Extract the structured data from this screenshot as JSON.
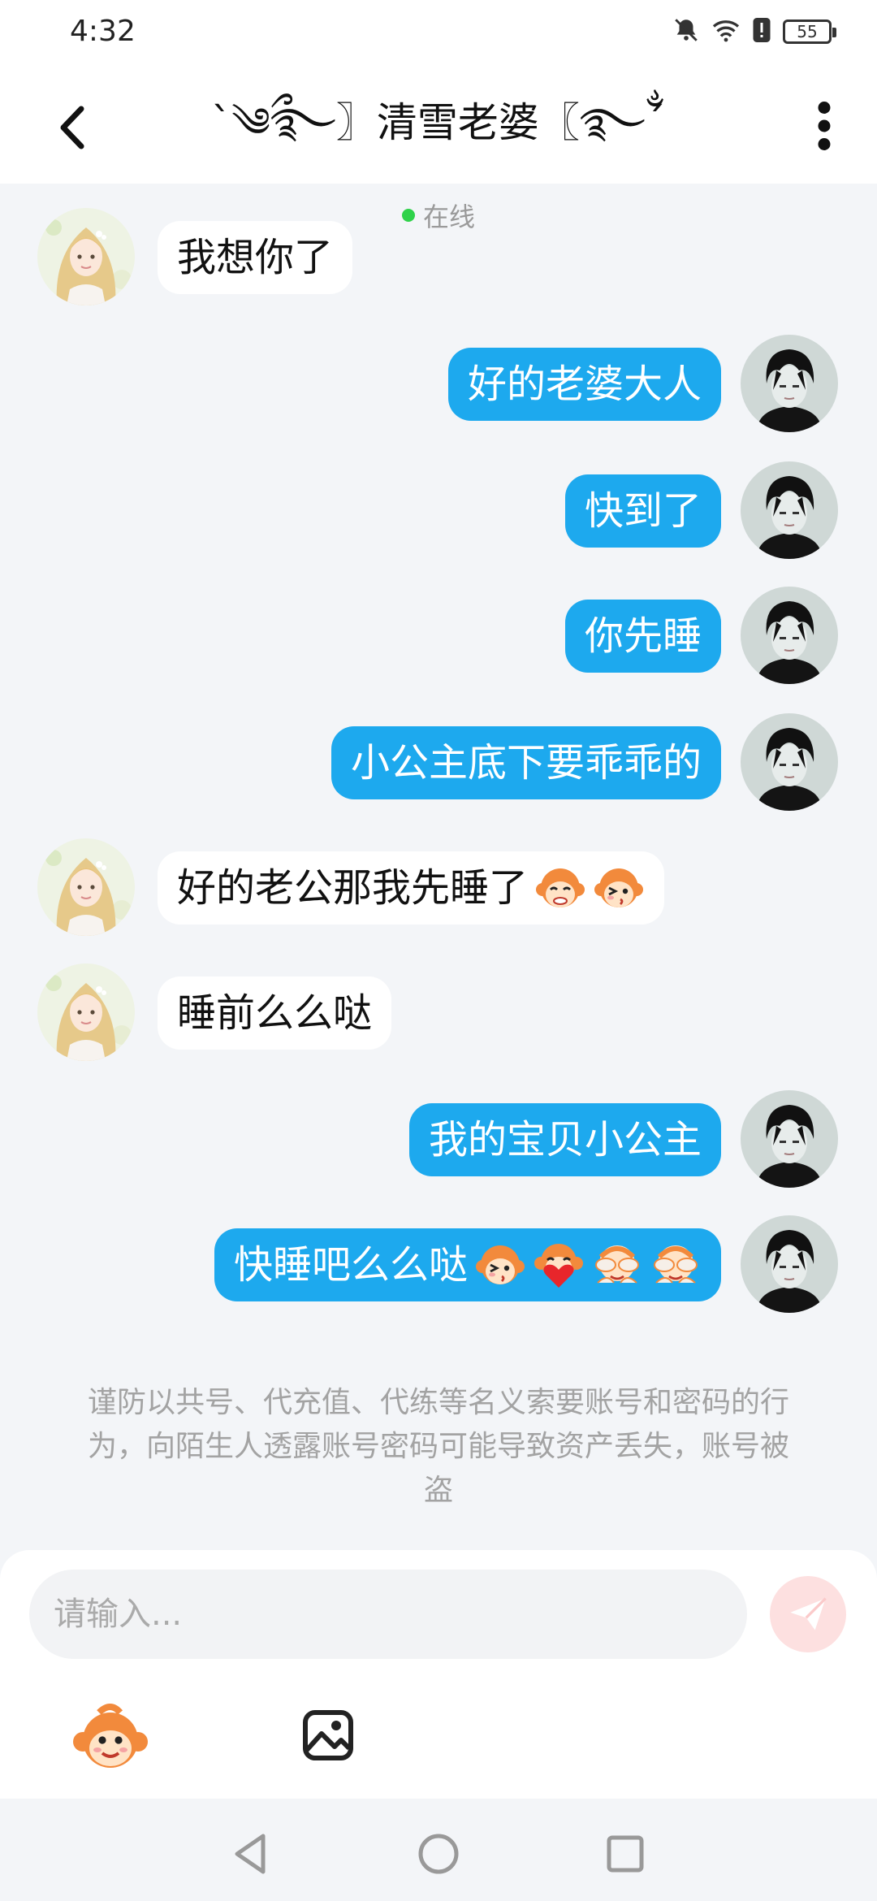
{
  "status_bar": {
    "time": "4:32",
    "battery": "55"
  },
  "header": {
    "title": "ˋ༄ྀ࿐〗清雪老婆〖࿐ྂˊ",
    "status": "在线",
    "icons": {
      "back": "chevron-left-icon",
      "more": "more-vertical-icon"
    }
  },
  "messages": [
    {
      "side": "in",
      "text": "我想你了",
      "emojis": []
    },
    {
      "side": "out",
      "text": "好的老婆大人",
      "emojis": []
    },
    {
      "side": "out",
      "text": "快到了",
      "emojis": []
    },
    {
      "side": "out",
      "text": "你先睡",
      "emojis": []
    },
    {
      "side": "out",
      "text": "小公主底下要乖乖的",
      "emojis": []
    },
    {
      "side": "in",
      "text": "好的老公那我先睡了",
      "emojis": [
        "monkey-shy-emoji",
        "monkey-kiss-emoji"
      ]
    },
    {
      "side": "in",
      "text": "睡前么么哒",
      "emojis": []
    },
    {
      "side": "out",
      "text": "我的宝贝小公主",
      "emojis": []
    },
    {
      "side": "out",
      "text": "快睡吧么么哒",
      "emojis": [
        "monkey-kiss-emoji",
        "monkey-heart-emoji",
        "monkey-cover-face-emoji",
        "monkey-cover-face-emoji"
      ]
    }
  ],
  "notice": "谨防以共号、代充值、代练等名义索要账号和密码的行为，向陌生人透露账号密码可能导致资产丢失，账号被盗",
  "composer": {
    "placeholder": "请输入...",
    "icons": {
      "send": "send-icon",
      "emoji": "monkey-emoji-icon",
      "image": "image-icon"
    }
  },
  "colors": {
    "out_bubble": "#1da9ee",
    "in_bubble": "#ffffff",
    "background": "#f3f5f8",
    "online": "#2fd24a"
  }
}
